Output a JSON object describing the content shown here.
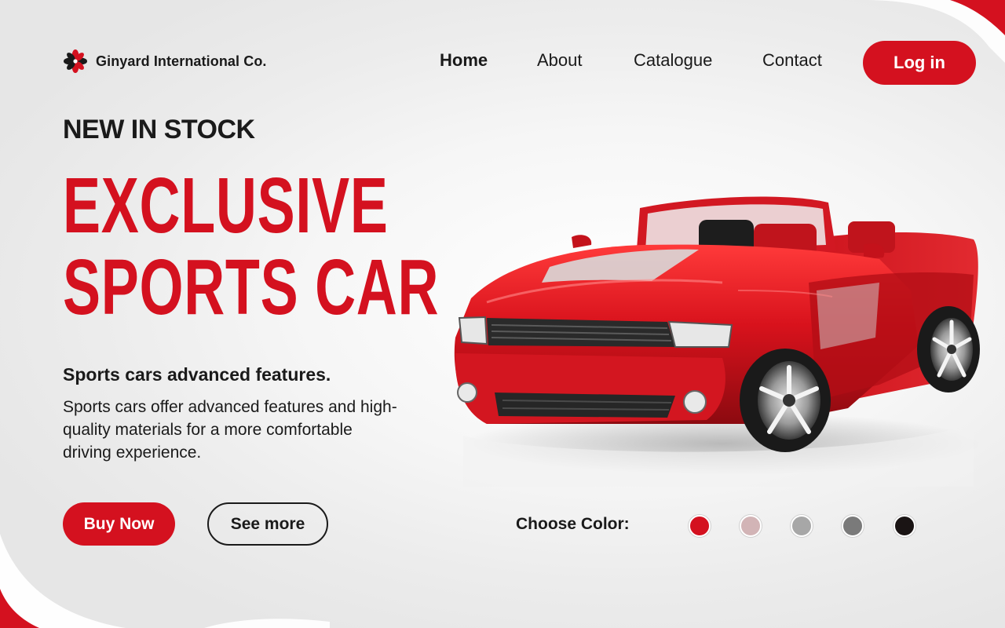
{
  "brand": {
    "name": "Ginyard International Co.",
    "accent": "#d4111f"
  },
  "nav": {
    "items": [
      {
        "label": "Home",
        "active": true
      },
      {
        "label": "About",
        "active": false
      },
      {
        "label": "Catalogue",
        "active": false
      },
      {
        "label": "Contact",
        "active": false
      }
    ],
    "login_label": "Log in"
  },
  "hero": {
    "eyebrow": "NEW IN STOCK",
    "headline_line1": "EXCLUSIVE",
    "headline_line2": "SPORTS CAR",
    "features_title": "Sports cars advanced features.",
    "features_body": "Sports cars offer advanced features and high-quality materials for a more comfortable driving experience.",
    "buy_label": "Buy Now",
    "more_label": "See more"
  },
  "product_image": {
    "subject": "red convertible sports car",
    "icon": "car-image"
  },
  "colors": {
    "label": "Choose Color:",
    "options": [
      "#d4111f",
      "#d2b4b6",
      "#a7a7a7",
      "#7a7a7a",
      "#1a1414"
    ],
    "selected_index": 0
  }
}
